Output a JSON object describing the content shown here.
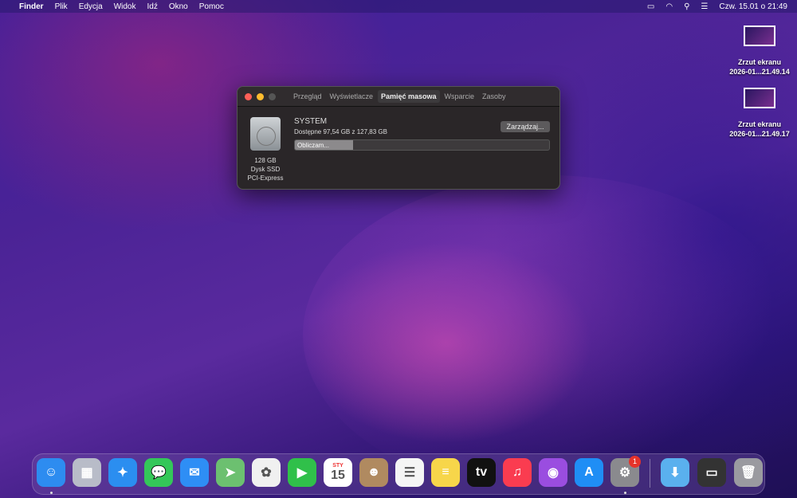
{
  "menubar": {
    "apple": "",
    "app": "Finder",
    "items": [
      "Plik",
      "Edycja",
      "Widok",
      "Idź",
      "Okno",
      "Pomoc"
    ],
    "clock": "Czw. 15.01 o  21:49"
  },
  "desktop": [
    {
      "name": "Zrzut ekranu",
      "sub": "2026-01...21.49.14"
    },
    {
      "name": "Zrzut ekranu",
      "sub": "2026-01...21.49.17"
    }
  ],
  "window": {
    "tabs": [
      "Przegląd",
      "Wyświetlacze",
      "Pamięć masowa",
      "Wsparcie",
      "Zasoby"
    ],
    "active_tab": 2,
    "disk": {
      "size": "128 GB",
      "type": "Dysk SSD",
      "interface": "PCI-Express"
    },
    "volume": "SYSTEM",
    "available": "Dostępne 97,54 GB z 127,83 GB",
    "progress_label": "Obliczam...",
    "progress": 0.23,
    "manage": "Zarządzaj..."
  },
  "dock": {
    "apps": [
      {
        "name": "finder",
        "glyph": "☺",
        "color": "#2d8cf0"
      },
      {
        "name": "launchpad",
        "glyph": "▦",
        "color": "#b8bcc8"
      },
      {
        "name": "safari",
        "glyph": "✦",
        "color": "#2b8ef0"
      },
      {
        "name": "messages",
        "glyph": "💬",
        "color": "#34c759"
      },
      {
        "name": "mail",
        "glyph": "✉",
        "color": "#2e8ef5"
      },
      {
        "name": "maps",
        "glyph": "➤",
        "color": "#6cc070"
      },
      {
        "name": "photos",
        "glyph": "✿",
        "color": "#f0f0f0"
      },
      {
        "name": "facetime",
        "glyph": "▶",
        "color": "#30c04a"
      },
      {
        "name": "calendar",
        "glyph": "15",
        "color": "#ffffff"
      },
      {
        "name": "contacts",
        "glyph": "☻",
        "color": "#b08a60"
      },
      {
        "name": "reminders",
        "glyph": "☰",
        "color": "#f5f5f5"
      },
      {
        "name": "notes",
        "glyph": "≡",
        "color": "#f7d64a"
      },
      {
        "name": "tv",
        "glyph": "tv",
        "color": "#111111"
      },
      {
        "name": "music",
        "glyph": "♫",
        "color": "#fa3c50"
      },
      {
        "name": "podcasts",
        "glyph": "◉",
        "color": "#9a4de0"
      },
      {
        "name": "app-store",
        "glyph": "A",
        "color": "#1f8ef5"
      },
      {
        "name": "system-preferences",
        "glyph": "⚙",
        "color": "#8a8a8e"
      }
    ],
    "calendar_month": "STY",
    "badge": "1",
    "right": [
      {
        "name": "downloads",
        "glyph": "⬇",
        "color": "#5ab0ee"
      },
      {
        "name": "screenshots-stack",
        "glyph": "▭",
        "color": "#333333"
      },
      {
        "name": "trash",
        "glyph": "🗑",
        "color": "#9a9aa0"
      }
    ]
  }
}
